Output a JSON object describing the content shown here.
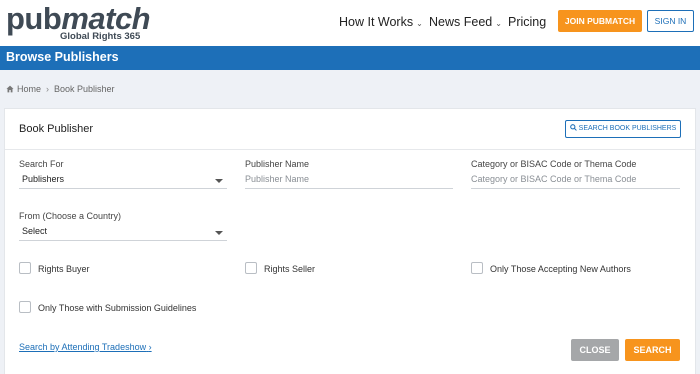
{
  "header": {
    "logo_main": "pub",
    "logo_accent": "match",
    "logo_sub": "Global Rights 365",
    "nav": [
      "How It Works",
      "News Feed",
      "Pricing"
    ],
    "join_label": "JOIN PUBMATCH",
    "signin_label": "SIGN IN"
  },
  "band": {
    "title": "Browse Publishers"
  },
  "breadcrumb": {
    "home": "Home",
    "current": "Book Publisher"
  },
  "card": {
    "title": "Book Publisher",
    "search_publishers_label": "SEARCH BOOK PUBLISHERS",
    "search_for": {
      "label": "Search For",
      "value": "Publishers"
    },
    "publisher_name": {
      "label": "Publisher Name",
      "placeholder": "Publisher Name"
    },
    "category": {
      "label": "Category or BISAC Code or Thema Code",
      "placeholder": "Category or BISAC Code or Thema Code"
    },
    "country": {
      "label": "From (Choose a Country)",
      "value": "Select"
    },
    "checkboxes": {
      "rights_buyer": "Rights Buyer",
      "rights_seller": "Rights Seller",
      "new_authors": "Only Those Accepting New Authors",
      "submission": "Only Those with Submission Guidelines"
    },
    "tradeshow_link": "Search by Attending Tradeshow",
    "close_label": "CLOSE",
    "search_label": "SEARCH"
  },
  "colors": {
    "brand_blue": "#1d6fb8",
    "accent_orange": "#f7941d",
    "close_gray": "#a5a7a9"
  }
}
